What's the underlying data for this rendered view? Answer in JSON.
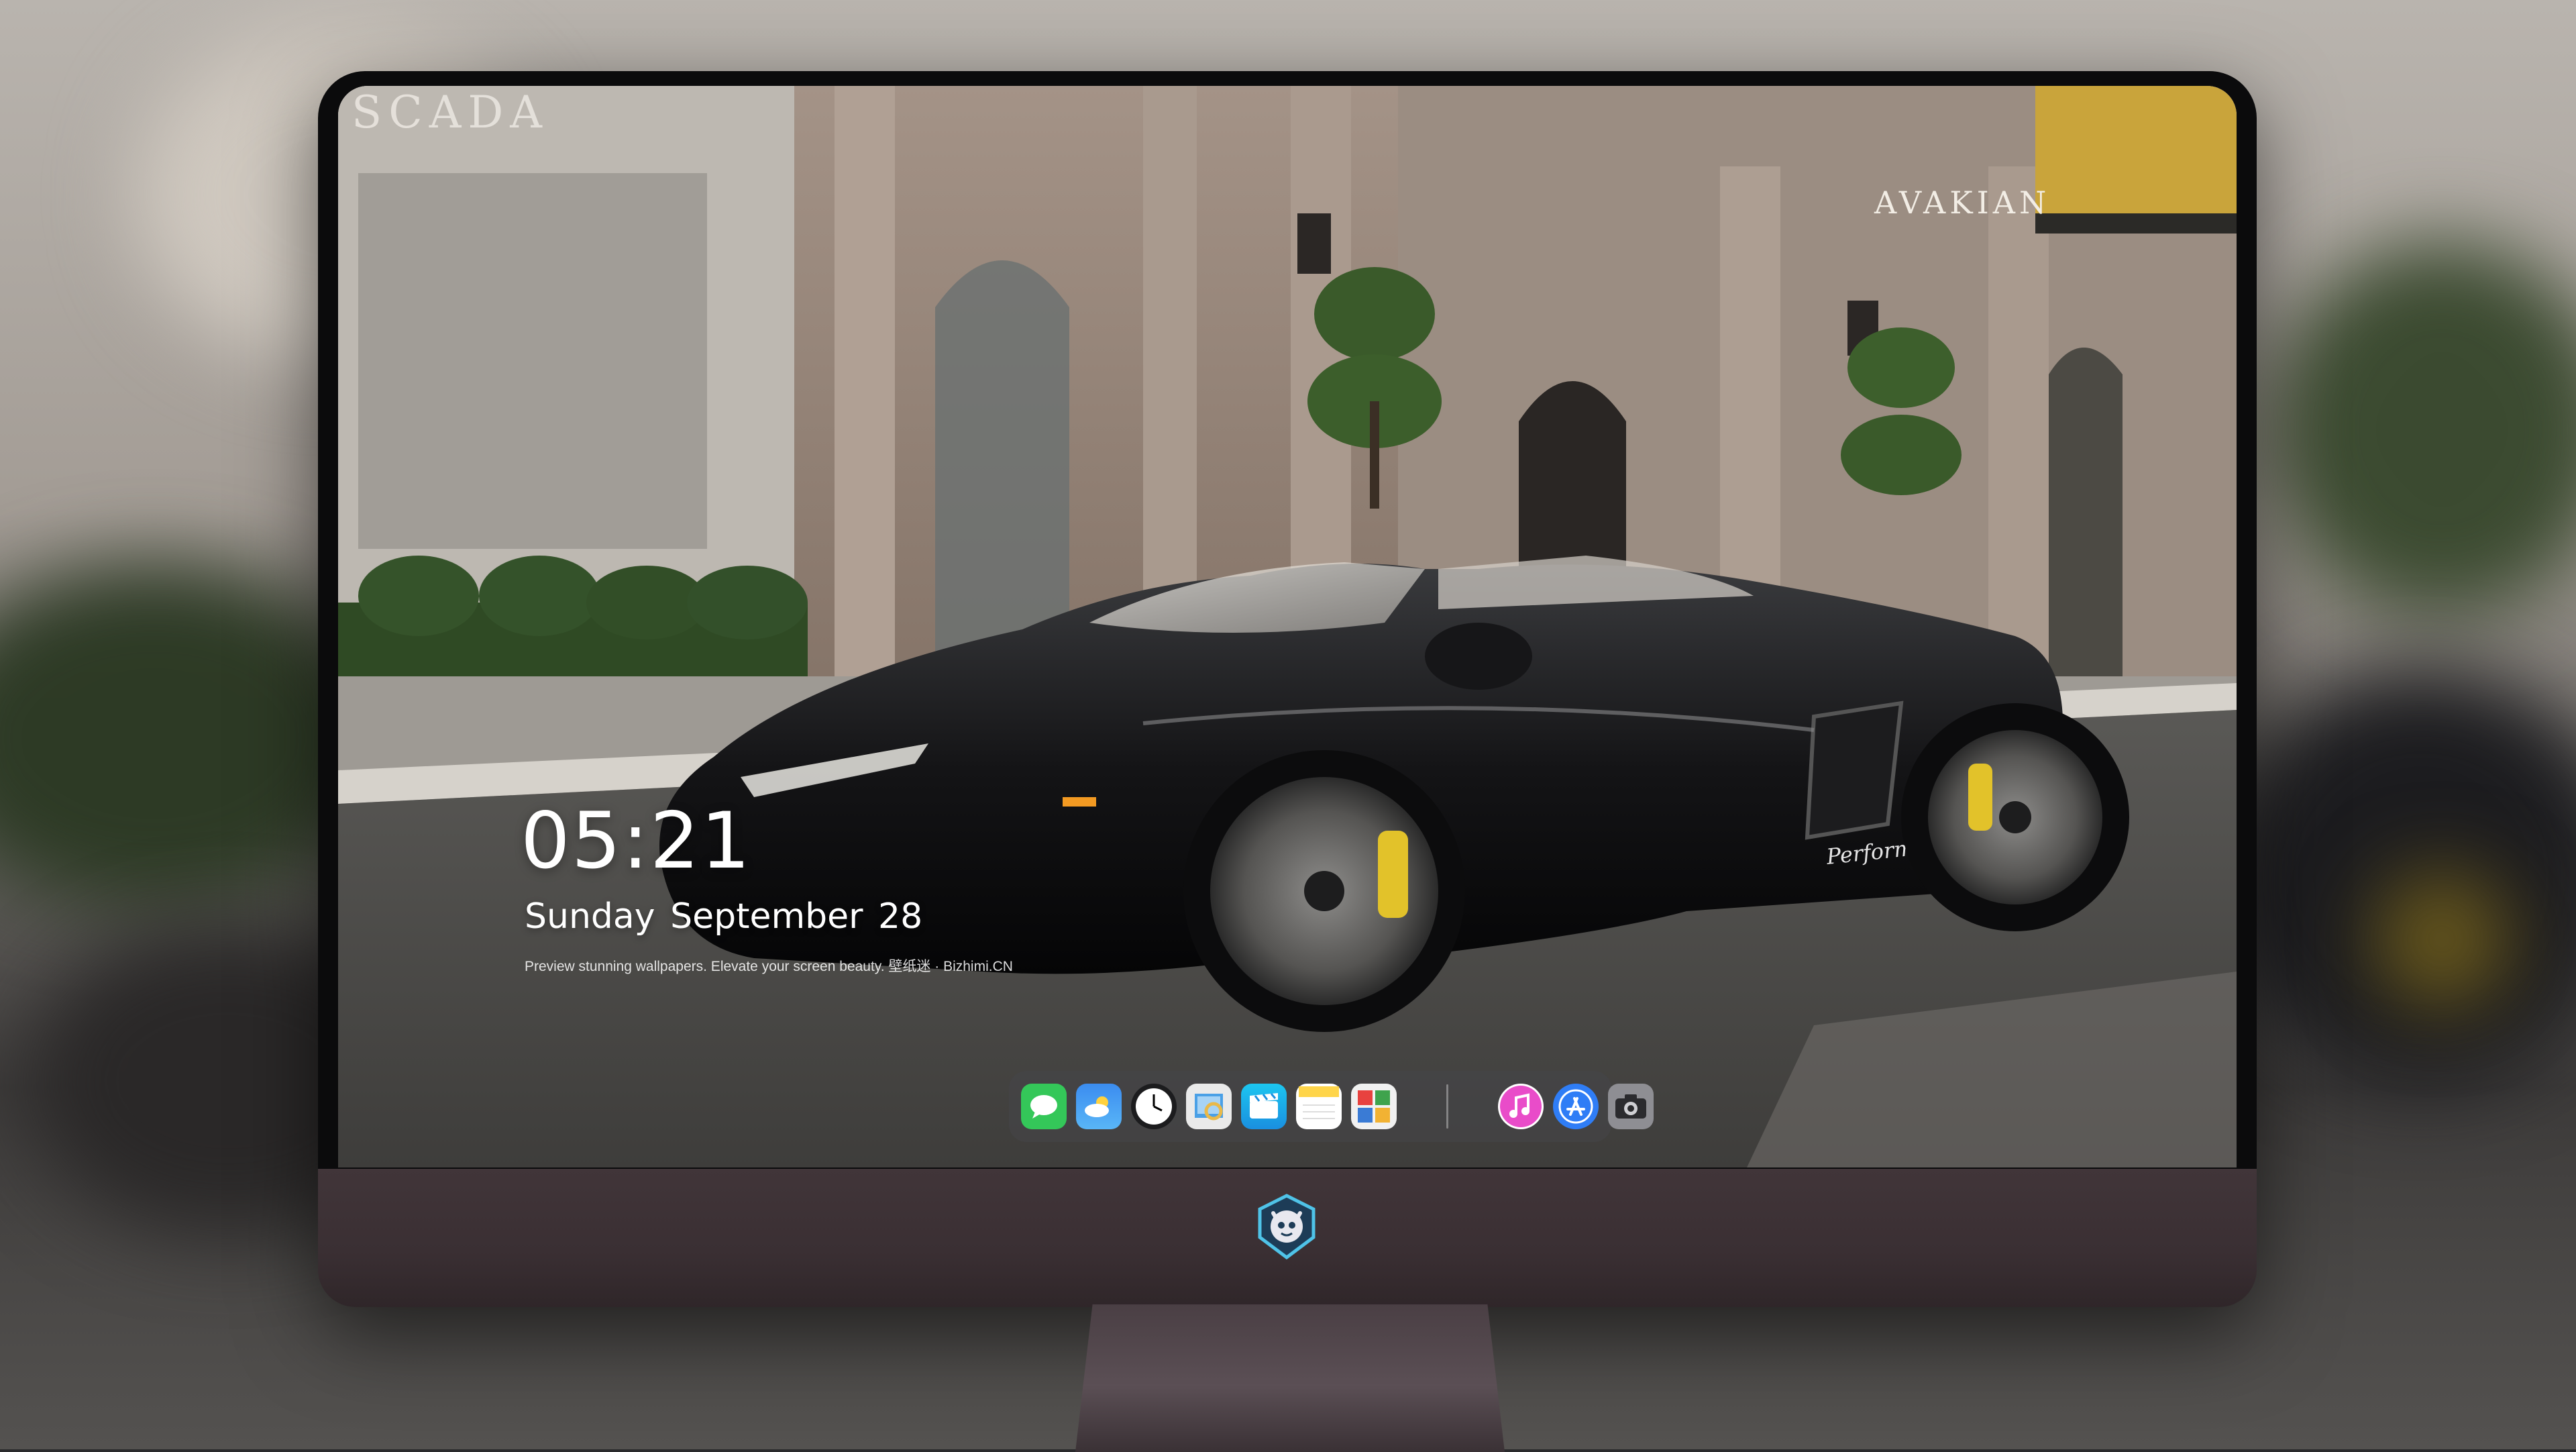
{
  "lock_screen": {
    "time": "05:21",
    "date": "Sunday September  28",
    "tagline": "Preview stunning wallpapers. Elevate your screen beauty. 壁纸迷 · Bizhimi.CN"
  },
  "wallpaper": {
    "store_sign_left": "SCADA",
    "store_sign_right": "AVAKIAN",
    "car_badge": "Performante"
  },
  "dock": {
    "apps": [
      {
        "name": "messages-icon",
        "color": "#34c759"
      },
      {
        "name": "weather-icon",
        "color": "#3aa0f5"
      },
      {
        "name": "clock-icon",
        "color": "#1c1c1e"
      },
      {
        "name": "preview-icon",
        "color": "#e9b949"
      },
      {
        "name": "clips-icon",
        "color": "#22b7ea"
      },
      {
        "name": "notes-icon",
        "color": "#ffd54a"
      },
      {
        "name": "photo-booth-icon",
        "color": "#f2f2f2"
      },
      {
        "name": "itunes-icon",
        "color": "#e94cc9"
      },
      {
        "name": "app-store-icon",
        "color": "#2f7df6"
      },
      {
        "name": "camera-icon",
        "color": "#7b7b80"
      }
    ]
  },
  "chin": {
    "logo": "mascot-logo-icon"
  }
}
